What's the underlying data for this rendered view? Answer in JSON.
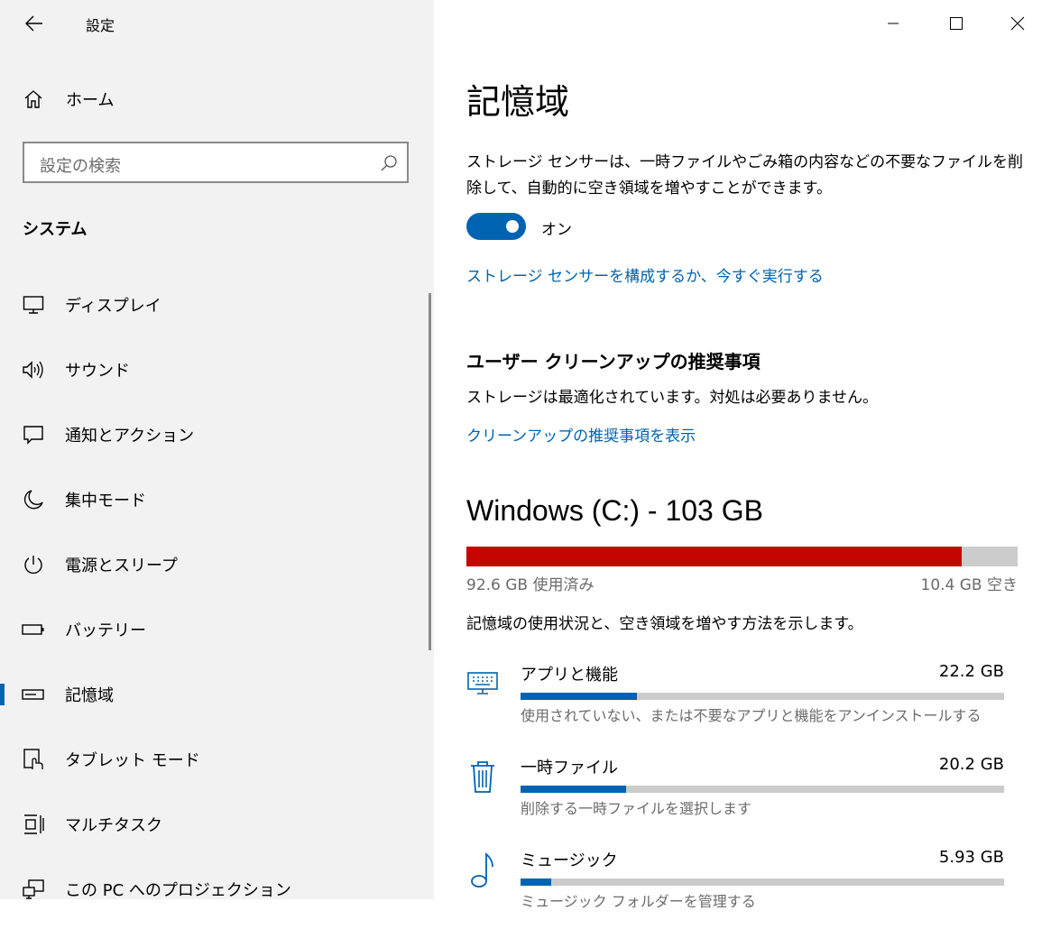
{
  "window": {
    "title": "設定",
    "controls": {
      "minimize": "minimize-icon",
      "maximize": "maximize-icon",
      "close": "close-icon"
    }
  },
  "sidebar": {
    "home_label": "ホーム",
    "search_placeholder": "設定の検索",
    "section": "システム",
    "items": [
      {
        "label": "ディスプレイ",
        "icon": "monitor-icon"
      },
      {
        "label": "サウンド",
        "icon": "speaker-icon"
      },
      {
        "label": "通知とアクション",
        "icon": "notification-icon"
      },
      {
        "label": "集中モード",
        "icon": "moon-icon"
      },
      {
        "label": "電源とスリープ",
        "icon": "power-icon"
      },
      {
        "label": "バッテリー",
        "icon": "battery-icon"
      },
      {
        "label": "記憶域",
        "icon": "storage-icon",
        "selected": true
      },
      {
        "label": "タブレット モード",
        "icon": "tablet-icon"
      },
      {
        "label": "マルチタスク",
        "icon": "multitask-icon"
      },
      {
        "label": "この PC へのプロジェクション",
        "icon": "projection-icon"
      }
    ]
  },
  "main": {
    "title": "記憶域",
    "storage_sense_desc": "ストレージ センサーは、一時ファイルやごみ箱の内容などの不要なファイルを削除して、自動的に空き領域を増やすことができます。",
    "toggle_state": "オン",
    "configure_link": "ストレージ センサーを構成するか、今すぐ実行する",
    "cleanup_title": "ユーザー クリーンアップの推奨事項",
    "cleanup_status": "ストレージは最適化されています。対処は必要ありません。",
    "cleanup_link": "クリーンアップの推奨事項を表示",
    "drive": {
      "title": "Windows (C:) - 103 GB",
      "used_label": "92.6 GB 使用済み",
      "free_label": "10.4 GB 空き",
      "used_fraction": 0.899,
      "bar_color": "#c50500"
    },
    "usage_desc": "記憶域の使用状況と、空き領域を増やす方法を示します。",
    "categories": [
      {
        "name": "アプリと機能",
        "size": "22.2 GB",
        "hint": "使用されていない、または不要なアプリと機能をアンインストールする",
        "fraction": 0.24,
        "icon": "keyboard-icon"
      },
      {
        "name": "一時ファイル",
        "size": "20.2 GB",
        "hint": "削除する一時ファイルを選択します",
        "fraction": 0.218,
        "icon": "trash-icon"
      },
      {
        "name": "ミュージック",
        "size": "5.93 GB",
        "hint": "ミュージック フォルダーを管理する",
        "fraction": 0.064,
        "icon": "music-note-icon"
      }
    ],
    "accent_color": "#0063b1"
  }
}
